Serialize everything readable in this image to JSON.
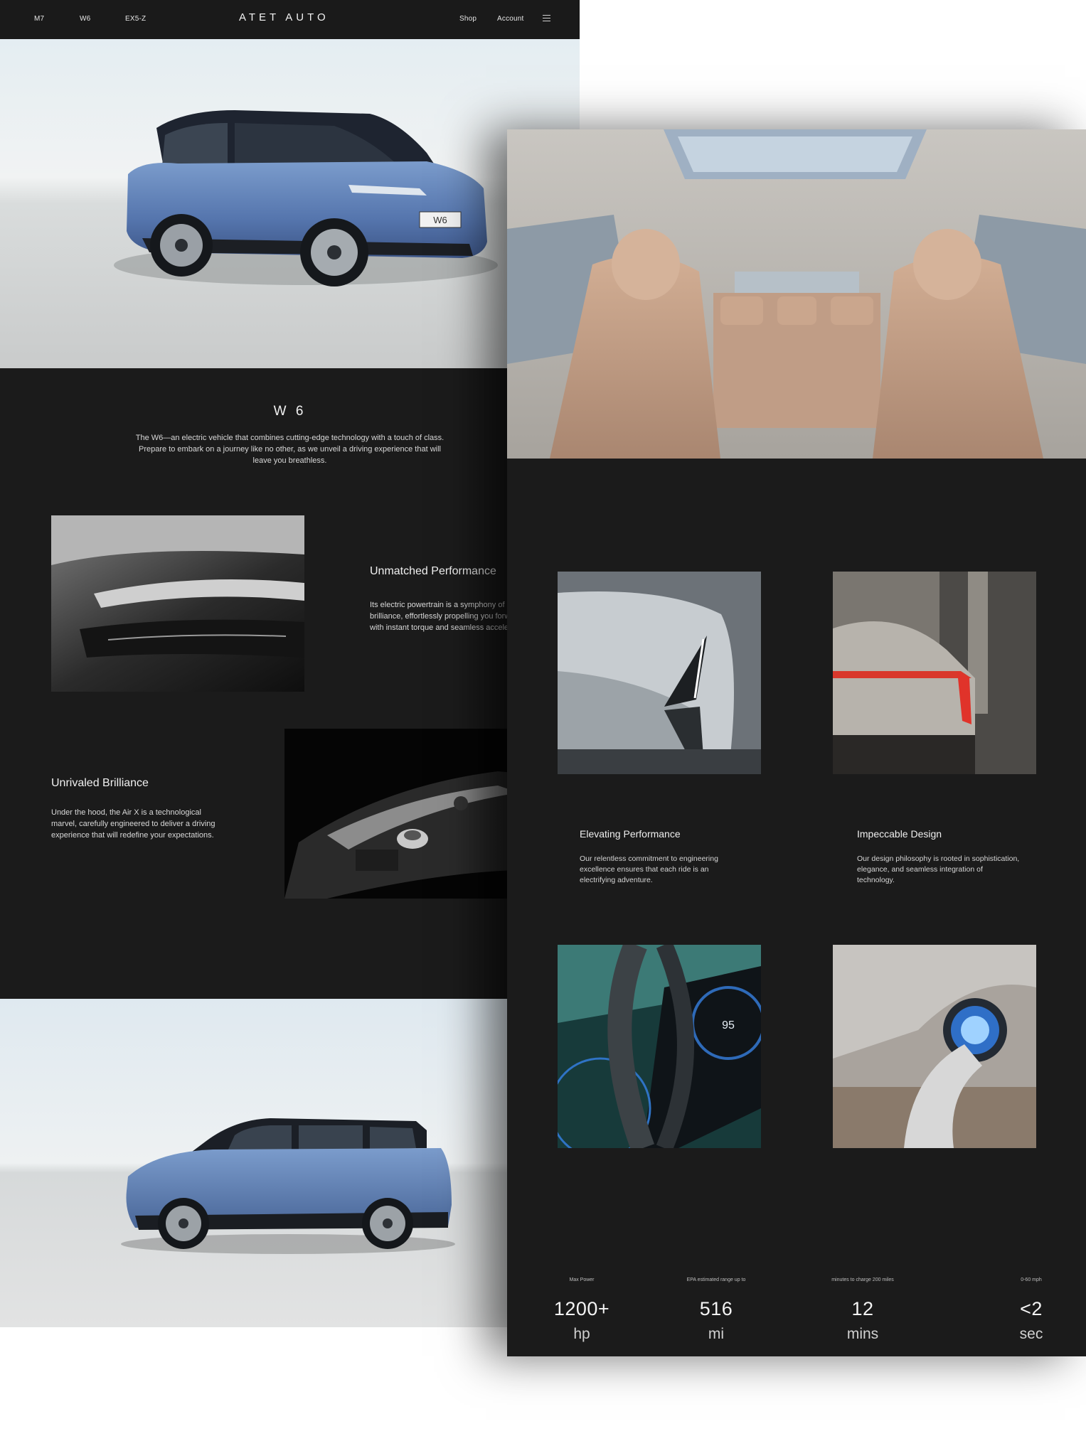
{
  "nav": {
    "links": [
      "M7",
      "W6",
      "EX5-Z"
    ],
    "brand": "ATET AUTO",
    "right_links": [
      "Shop",
      "Account"
    ]
  },
  "hero": {
    "plate_text": "W6"
  },
  "intro": {
    "title": "W 6",
    "text": "The W6—an electric vehicle that combines cutting-edge technology with a touch of class. Prepare to embark on a journey like no other, as we unveil a driving experience that will leave you breathless."
  },
  "features": [
    {
      "title": "Unmatched Performance",
      "text": " Its electric powertrain is a symphony of brilliance, effortlessly propelling you forward with instant torque and seamless acceleration."
    },
    {
      "title": "Unrivaled Brilliance",
      "text": "Under the hood, the Air X is a technological marvel, carefully engineered to deliver a driving experience that will redefine your expectations."
    }
  ],
  "grid": [
    {
      "title": "Elevating Performance",
      "text": "Our relentless commitment to engineering excellence ensures that each ride is an electrifying adventure."
    },
    {
      "title": "Impeccable Design",
      "text": " Our design philosophy is rooted in sophistication, elegance, and seamless integration of technology."
    }
  ],
  "dash_readout": "95",
  "stats": [
    {
      "label": "Max Power",
      "value": "1200+",
      "unit": "hp"
    },
    {
      "label": "EPA estimated range up to",
      "value": "516",
      "unit": "mi"
    },
    {
      "label": "minutes to charge 200 miles",
      "value": "12",
      "unit": "mins"
    },
    {
      "label": "0-60 mph",
      "value": "<2",
      "unit": "sec"
    }
  ],
  "colors": {
    "page_bg": "#1b1b1b",
    "car_blue": "#5d7fb6",
    "seat_leather": "#c49f86",
    "tail_light": "#e0332a",
    "charge_blue": "#3a8ae0"
  }
}
